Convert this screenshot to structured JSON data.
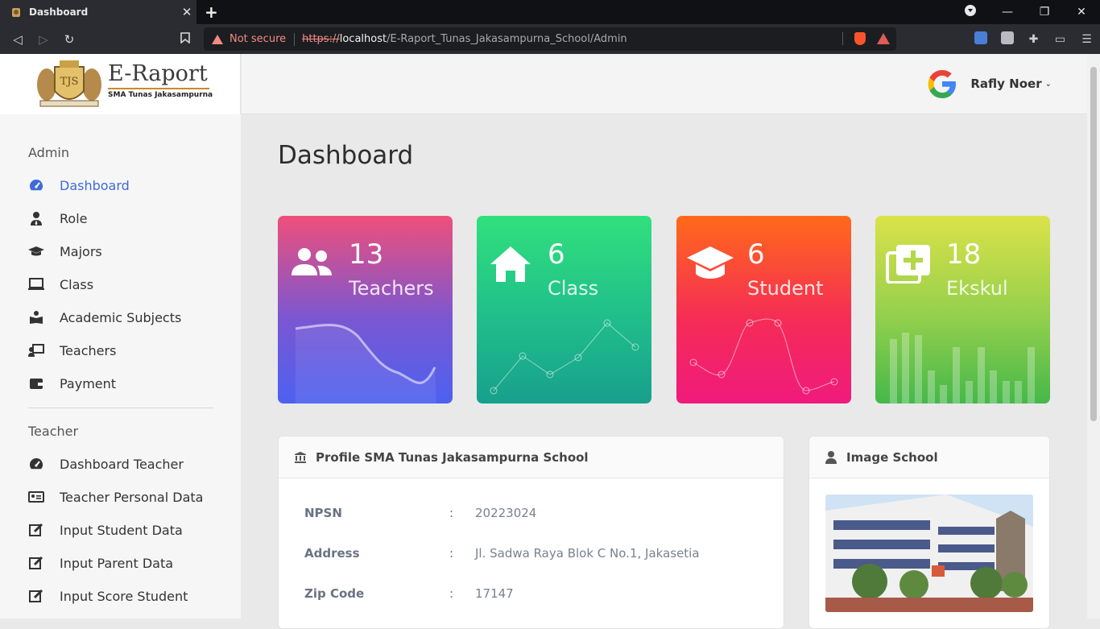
{
  "browser": {
    "tab_title": "Dashboard",
    "not_secure": "Not secure",
    "url_scheme": "https://",
    "url_host": "localhost",
    "url_path": "/E-Raport_Tunas_Jakasampurna_School/Admin"
  },
  "brand": {
    "title": "E-Raport",
    "subtitle": "SMA Tunas Jakasampurna"
  },
  "user": {
    "name": "Rafly Noer"
  },
  "sidebar": {
    "admin_header": "Admin",
    "admin_items": [
      {
        "label": "Dashboard",
        "icon": "tachometer-icon"
      },
      {
        "label": "Role",
        "icon": "user-tie-icon"
      },
      {
        "label": "Majors",
        "icon": "graduation-cap-icon"
      },
      {
        "label": "Class",
        "icon": "laptop-icon"
      },
      {
        "label": "Academic Subjects",
        "icon": "book-reader-icon"
      },
      {
        "label": "Teachers",
        "icon": "chalkboard-teacher-icon"
      },
      {
        "label": "Payment",
        "icon": "wallet-icon"
      }
    ],
    "teacher_header": "Teacher",
    "teacher_items": [
      {
        "label": "Dashboard Teacher",
        "icon": "tachometer-icon"
      },
      {
        "label": "Teacher Personal Data",
        "icon": "id-card-icon"
      },
      {
        "label": "Input Student Data",
        "icon": "edit-icon"
      },
      {
        "label": "Input Parent Data",
        "icon": "edit-icon"
      },
      {
        "label": "Input Score Student",
        "icon": "edit-icon"
      }
    ]
  },
  "page": {
    "title": "Dashboard"
  },
  "cards": [
    {
      "count": "13",
      "label": "Teachers",
      "icon": "users-icon"
    },
    {
      "count": "6",
      "label": "Class",
      "icon": "home-icon"
    },
    {
      "count": "6",
      "label": "Student",
      "icon": "graduation-cap-icon"
    },
    {
      "count": "18",
      "label": "Ekskul",
      "icon": "plus-square-icon"
    }
  ],
  "profile": {
    "title": "Profile SMA Tunas Jakasampurna School",
    "rows": [
      {
        "label": "NPSN",
        "value": "20223024"
      },
      {
        "label": "Address",
        "value": "Jl. Sadwa Raya Blok C No.1, Jakasetia"
      },
      {
        "label": "Zip Code",
        "value": "17147"
      }
    ]
  },
  "image_school": {
    "title": "Image School"
  }
}
